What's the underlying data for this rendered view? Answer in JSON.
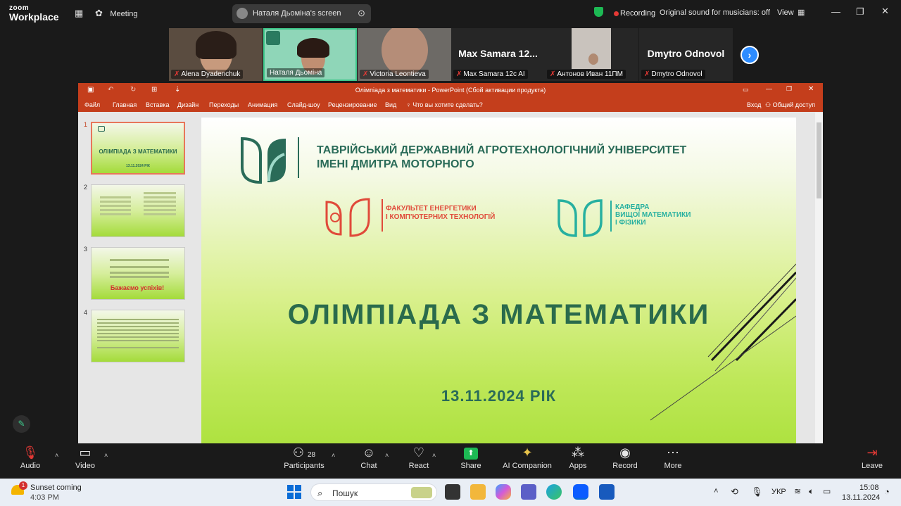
{
  "zoom": {
    "logo_line1": "zoom",
    "logo_line2": "Workplace",
    "meeting_label": "Meeting",
    "screen_share_label": "Наталя Дьоміна's screen",
    "recording_label": "Recording",
    "original_sound_label": "Original sound for musicians: off",
    "view_label": "View"
  },
  "participants": [
    {
      "name": "Alena Dyadenchuk",
      "muted": true
    },
    {
      "name": "Наталя Дьоміна",
      "muted": false
    },
    {
      "name": "Victoria Leontieva",
      "muted": true
    },
    {
      "name": "Max Samara 12c AI",
      "display": "Max Samara 12...",
      "muted": true
    },
    {
      "name": "Антонов Иван 11ПМ",
      "muted": true
    },
    {
      "name": "Dmytro Odnovol",
      "display": "Dmytro Odnovol",
      "muted": true
    }
  ],
  "ppt": {
    "title": "Олімпіада з математики - PowerPoint (Сбой активации продукта)",
    "menu": [
      "Файл",
      "Главная",
      "Вставка",
      "Дизайн",
      "Переходы",
      "Анимация",
      "Слайд-шоу",
      "Рецензирование",
      "Вид"
    ],
    "tell_me": "Что вы хотите сделать?",
    "signin": "Вход",
    "share": "Общий доступ",
    "thumb_numbers": [
      "1",
      "2",
      "3",
      "4"
    ],
    "thumb1_title": "ОЛІМПІАДА З МАТЕМАТИКИ",
    "thumb1_date": "13.11.2024 РІК",
    "thumb3_line": "Бажаємо успіхів!"
  },
  "slide": {
    "university_line1": "ТАВРІЙСЬКИЙ ДЕРЖАВНИЙ АГРОТЕХНОЛОГІЧНИЙ УНІВЕРСИТЕТ",
    "university_line2": "ІМЕНІ ДМИТРА МОТОРНОГО",
    "faculty_line1": "ФАКУЛЬТЕТ ЕНЕРГЕТИКИ",
    "faculty_line2": "І КОМП'ЮТЕРНИХ ТЕХНОЛОГІЙ",
    "dept_line1": "КАФЕДРА",
    "dept_line2": "ВИЩОЇ МАТЕМАТИКИ",
    "dept_line3": "І ФІЗИКИ",
    "title": "ОЛІМПІАДА З МАТЕМАТИКИ",
    "date": "13.11.2024 РІК"
  },
  "toolbar": {
    "audio": "Audio",
    "video": "Video",
    "participants": "Participants",
    "participants_count": "28",
    "chat": "Chat",
    "react": "React",
    "share": "Share",
    "ai_companion": "AI Companion",
    "apps": "Apps",
    "record": "Record",
    "more": "More",
    "leave": "Leave"
  },
  "taskbar": {
    "weather_title": "Sunset coming",
    "weather_time": "4:03 PM",
    "weather_badge": "1",
    "search_placeholder": "Пошук",
    "lang": "УКР",
    "time": "15:08",
    "date": "13.11.2024"
  },
  "colors": {
    "ppt_red": "#c43e1c",
    "zoom_blue": "#2d8cff",
    "share_green": "#1db954",
    "slide_green": "#2a6b4c"
  }
}
